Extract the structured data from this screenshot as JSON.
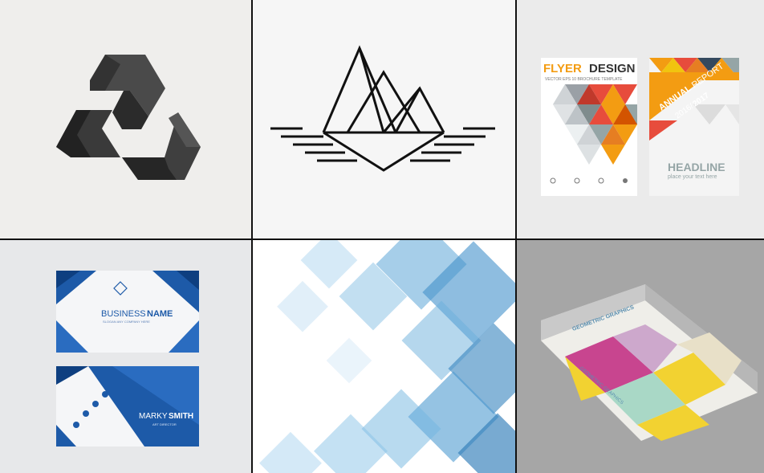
{
  "gallery": {
    "flyer": {
      "title_part1": "FLYER",
      "title_part2": "DESIGN",
      "subtitle": "VECTOR EPS 10 BROCHURE TEMPLATE",
      "annual_report_word1": "ANNUAL",
      "annual_report_word2": "REPORT",
      "years_part1": "2016/",
      "years_part2": "2017",
      "headline": "HEADLINE",
      "headline_sub": "place your text here"
    },
    "business_card": {
      "name_part1": "BUSINESS",
      "name_part2": "NAME",
      "tagline": "SLOGAN ANY COMPANY HERE",
      "person_part1": "MARKY",
      "person_part2": "SMITH",
      "role": "ART DIRECTOR"
    },
    "book": {
      "cover_title": "GEOMETRIC GRAPHICS",
      "spine_title": "GEOMETRIC GRAPHICS"
    }
  },
  "colors": {
    "flyer_orange": "#f39c12",
    "flyer_red": "#e74c3c",
    "card_blue": "#1d5aa8",
    "book_pink": "#c8458f",
    "book_yellow": "#f2d231",
    "book_mint": "#a9d8c6"
  }
}
